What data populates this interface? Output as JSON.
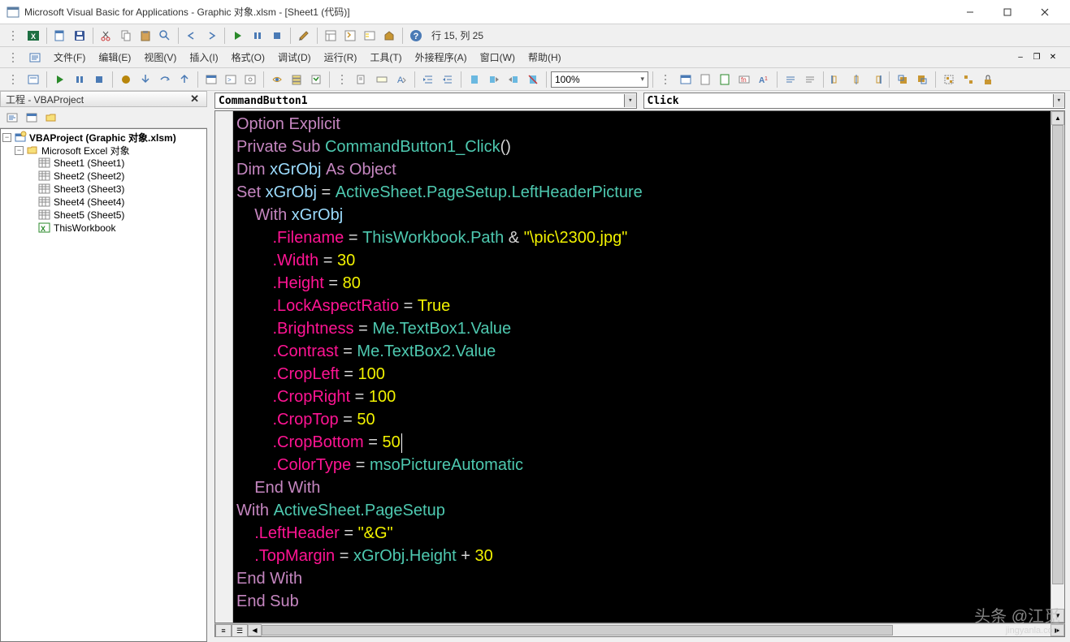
{
  "title": "Microsoft Visual Basic for Applications - Graphic 对象.xlsm - [Sheet1 (代码)]",
  "cursor_pos": "行 15, 列 25",
  "menus": {
    "file": "文件(F)",
    "edit": "编辑(E)",
    "view": "视图(V)",
    "insert": "插入(I)",
    "format": "格式(O)",
    "debug": "调试(D)",
    "run": "运行(R)",
    "tools": "工具(T)",
    "addins": "外接程序(A)",
    "window": "窗口(W)",
    "help": "帮助(H)"
  },
  "zoom": "100%",
  "project": {
    "title": "工程 - VBAProject",
    "root": "VBAProject (Graphic 对象.xlsm)",
    "folder": "Microsoft Excel 对象",
    "items": [
      "Sheet1 (Sheet1)",
      "Sheet2 (Sheet2)",
      "Sheet3 (Sheet3)",
      "Sheet4 (Sheet4)",
      "Sheet5 (Sheet5)",
      "ThisWorkbook"
    ]
  },
  "dropdowns": {
    "object": "CommandButton1",
    "proc": "Click"
  },
  "code": {
    "l1_a": "Option Explicit",
    "l2_a": "Private Sub",
    "l2_b": "CommandButton1_Click",
    "l2_c": "()",
    "l3_a": "Dim",
    "l3_b": "xGrObj",
    "l3_c": "As Object",
    "l4_a": "Set",
    "l4_b": "xGrObj",
    "l4_c": "=",
    "l4_d": "ActiveSheet.PageSetup.LeftHeaderPicture",
    "l5_a": "With",
    "l5_b": "xGrObj",
    "l6_a": ".Filename",
    "l6_b": "=",
    "l6_c": "ThisWorkbook.Path",
    "l6_d": "&",
    "l6_e": "\"\\pic\\2300.jpg\"",
    "l7_a": ".Width",
    "l7_b": "=",
    "l7_c": "30",
    "l8_a": ".Height",
    "l8_b": "=",
    "l8_c": "80",
    "l9_a": ".LockAspectRatio",
    "l9_b": "=",
    "l9_c": "True",
    "l10_a": ".Brightness",
    "l10_b": "=",
    "l10_c": "Me.TextBox1.Value",
    "l11_a": ".Contrast",
    "l11_b": "=",
    "l11_c": "Me.TextBox2.Value",
    "l12_a": ".CropLeft",
    "l12_b": "=",
    "l12_c": "100",
    "l13_a": ".CropRight",
    "l13_b": "=",
    "l13_c": "100",
    "l14_a": ".CropTop",
    "l14_b": "=",
    "l14_c": "50",
    "l15_a": ".CropBottom",
    "l15_b": "=",
    "l15_c": "50",
    "l16_a": ".ColorType",
    "l16_b": "=",
    "l16_c": "msoPictureAutomatic",
    "l17_a": "End With",
    "l18_a": "With",
    "l18_b": "ActiveSheet.PageSetup",
    "l19_a": ".LeftHeader",
    "l19_b": "=",
    "l19_c": "\"&G\"",
    "l20_a": ".TopMargin",
    "l20_b": "=",
    "l20_c": "xGrObj.Height",
    "l20_d": "+",
    "l20_e": "30",
    "l21_a": "End With",
    "l22_a": "End Sub"
  },
  "watermark": {
    "main": "头条 @江觅",
    "sub": "jingyanla.com"
  }
}
